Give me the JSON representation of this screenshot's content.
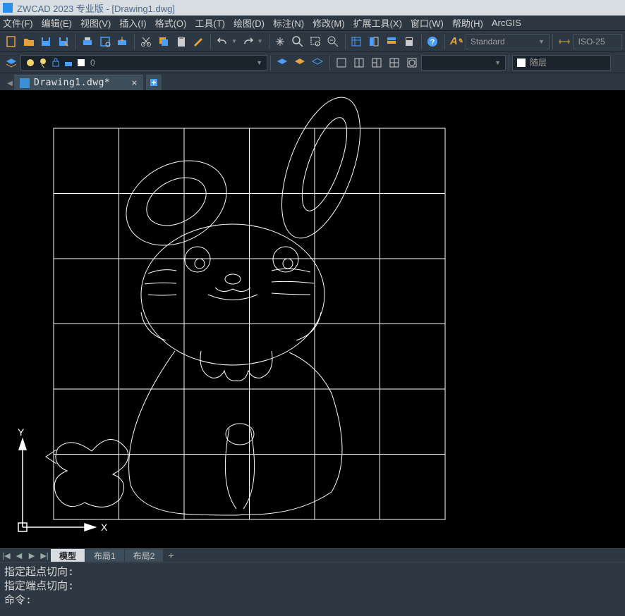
{
  "title": "ZWCAD 2023 专业版 - [Drawing1.dwg]",
  "menus": [
    "文件(F)",
    "编辑(E)",
    "视图(V)",
    "插入(I)",
    "格式(O)",
    "工具(T)",
    "绘图(D)",
    "标注(N)",
    "修改(M)",
    "扩展工具(X)",
    "窗口(W)",
    "帮助(H)",
    "ArcGIS"
  ],
  "styleBox": "Standard",
  "dimBox": "ISO-25",
  "layerBox": "0",
  "followBox": "随层",
  "docTab": "Drawing1.dwg*",
  "layoutTabs": {
    "model": "模型",
    "l1": "布局1",
    "l2": "布局2"
  },
  "cmd": {
    "l1": "指定起点切向:",
    "l2": "指定端点切向:",
    "l3": "命令:"
  },
  "ucs": {
    "x": "X",
    "y": "Y"
  }
}
